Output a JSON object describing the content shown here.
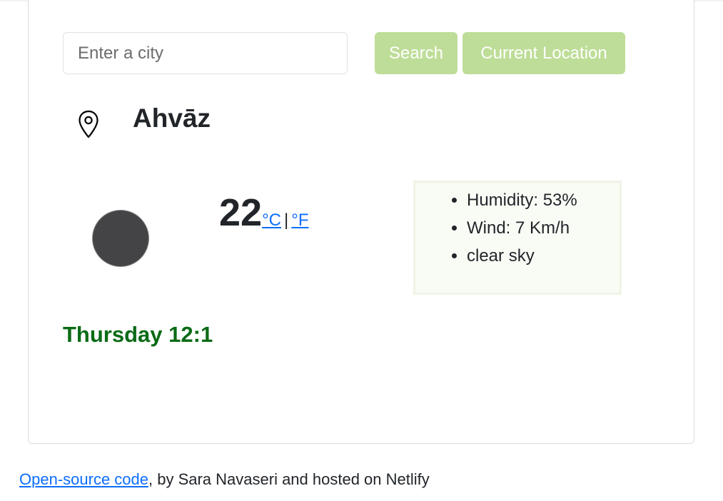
{
  "search": {
    "placeholder": "Enter a city",
    "value": "",
    "search_label": "Search",
    "location_label": "Current Location"
  },
  "location": {
    "city": "Ahvāz",
    "icon": "map-pin-icon"
  },
  "weather": {
    "icon": "weather-condition-icon",
    "temperature": "22",
    "unit_celsius": "°C",
    "unit_separator": "|",
    "unit_fahrenheit": "°F",
    "details": [
      "Humidity: 53%",
      "Wind: 7 Km/h",
      "clear sky"
    ],
    "datetime": "Thursday 12:1"
  },
  "footer": {
    "link_text": "Open-source code",
    "suffix": ", by Sara Navaseri and hosted on Netlify"
  },
  "colors": {
    "button_bg": "#bedd98",
    "datetime": "#0a6b16",
    "link": "#0d6efd"
  }
}
